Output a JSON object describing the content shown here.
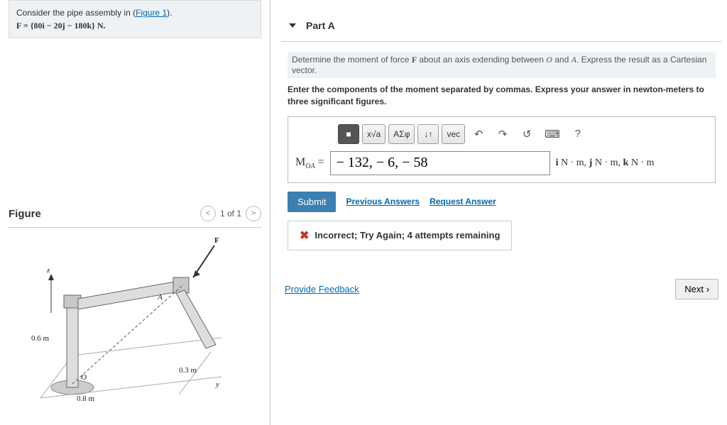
{
  "problem": {
    "intro": "Consider the pipe assembly in (",
    "figure_link": "Figure 1",
    "intro_end": ").",
    "force_eq": "F = {80i − 20j − 180k} N."
  },
  "figure": {
    "title": "Figure",
    "pager": "1 of 1",
    "labels": {
      "F": "F",
      "z": "z",
      "A": "A",
      "O": "O",
      "y": "y",
      "d1": "0.6 m",
      "d2": "0.8 m",
      "d3": "0.3 m"
    }
  },
  "part": {
    "title": "Part A",
    "instruction_pre": "Determine the moment of force ",
    "instruction_F": "F",
    "instruction_mid": " about an axis extending between ",
    "instruction_O": "O",
    "instruction_and": " and ",
    "instruction_A": "A",
    "instruction_post": ". Express the result as a Cartesian vector.",
    "instruction2": "Enter the components of the moment separated by commas. Express your answer in newton-meters to three significant figures.",
    "toolbar": {
      "templates": "■",
      "sqrt": "x√a",
      "greek": "ΑΣφ",
      "updown": "↓↑",
      "vec": "vec",
      "undo": "↶",
      "redo": "↷",
      "reset": "↺",
      "keyboard": "⌨",
      "help": "?"
    },
    "label_M": "M",
    "label_sub": "OA",
    "label_eq": " = ",
    "answer_value": "− 132, − 6, − 58",
    "units": "i N · m, j N · m, k N · m",
    "submit": "Submit",
    "prev": "Previous Answers",
    "request": "Request Answer",
    "feedback": "Incorrect; Try Again; 4 attempts remaining"
  },
  "footer": {
    "provide": "Provide Feedback",
    "next": "Next"
  }
}
